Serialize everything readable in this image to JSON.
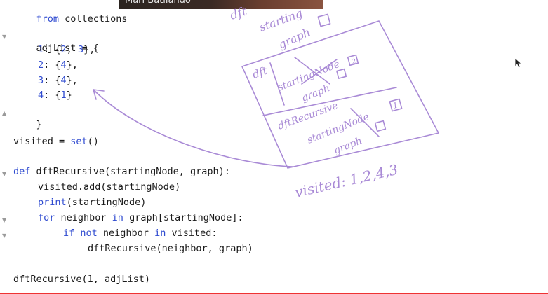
{
  "editor": {
    "lines": {
      "l1": {
        "kw": "from",
        "rest": " collections"
      },
      "l2": {
        "text": "adjList = {"
      },
      "l3": {
        "key": "1",
        "colon": ": {",
        "a": "2",
        "sep": ", ",
        "b": "3",
        "end": "},"
      },
      "l4": {
        "key": "2",
        "colon": ": {",
        "a": "4",
        "end": "},"
      },
      "l5": {
        "key": "3",
        "colon": ": {",
        "a": "4",
        "end": "},"
      },
      "l6": {
        "key": "4",
        "colon": ": {",
        "a": "1",
        "end": "}"
      },
      "l7": {
        "text": "}"
      },
      "l8": {
        "pre": "visited = ",
        "call": "set",
        "post": "()"
      },
      "l9": {
        "kw": "def",
        "rest": " dftRecursive(startingNode, graph):"
      },
      "l10": {
        "text": "visited.add(startingNode)"
      },
      "l11": {
        "call": "print",
        "rest": "(startingNode)"
      },
      "l12": {
        "kw": "for",
        "mid": " neighbor ",
        "kw2": "in",
        "rest": " graph[startingNode]:"
      },
      "l13": {
        "kw": "if not",
        "mid": " neighbor ",
        "kw2": "in",
        "rest": " visited:"
      },
      "l14": {
        "text": "dftRecursive(neighbor, graph)"
      },
      "l15": {
        "text": "dftRecursive(1, adjList)"
      }
    }
  },
  "video_overlay": {
    "caption": "Mari Batilando"
  },
  "annotations": {
    "top_word": "dft",
    "frame1_word": "starting",
    "frame1_word2": "graph",
    "dft_label": "dft",
    "starting_node_label": "startingNode",
    "node_value_2": "2",
    "graph_label": "graph",
    "dft_recursive_label": "dftRecursive",
    "starting_node_label2": "startingNode",
    "node_value_1": "1",
    "graph_label2": "graph",
    "visited_text": "visited: 1,2,4,3"
  },
  "colors": {
    "keyword": "#2f4bd0",
    "ink": "#a98ad6"
  }
}
